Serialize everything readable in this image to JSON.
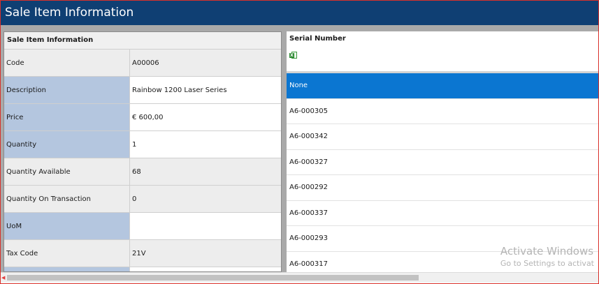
{
  "window": {
    "title": "Sale Item Information"
  },
  "left_panel": {
    "header": "Sale Item Information",
    "rows": [
      {
        "label": "Code",
        "value": "A00006",
        "style": "gray"
      },
      {
        "label": "Description",
        "value": "Rainbow 1200 Laser Series",
        "style": "blue"
      },
      {
        "label": "Price",
        "value": "€ 600,00",
        "style": "blue"
      },
      {
        "label": "Quantity",
        "value": "1",
        "style": "blue"
      },
      {
        "label": "Quantity Available",
        "value": "68",
        "style": "gray"
      },
      {
        "label": "Quantity On Transaction",
        "value": "0",
        "style": "gray"
      },
      {
        "label": "UoM",
        "value": "",
        "style": "blue"
      },
      {
        "label": "Tax Code",
        "value": "21V",
        "style": "gray"
      },
      {
        "label": "",
        "value": "",
        "style": "blue"
      }
    ]
  },
  "right_panel": {
    "header": "Serial Number",
    "export_icon": "excel-export-icon",
    "selected_index": 0,
    "items": [
      "None",
      "A6-000305",
      "A6-000342",
      "A6-000327",
      "A6-000292",
      "A6-000337",
      "A6-000293",
      "A6-000317"
    ]
  },
  "watermark": {
    "line1": "Activate Windows",
    "line2": "Go to Settings to activat"
  },
  "colors": {
    "titlebar": "#0f3f73",
    "selected": "#0b76d1",
    "label_blue": "#b4c6df"
  }
}
